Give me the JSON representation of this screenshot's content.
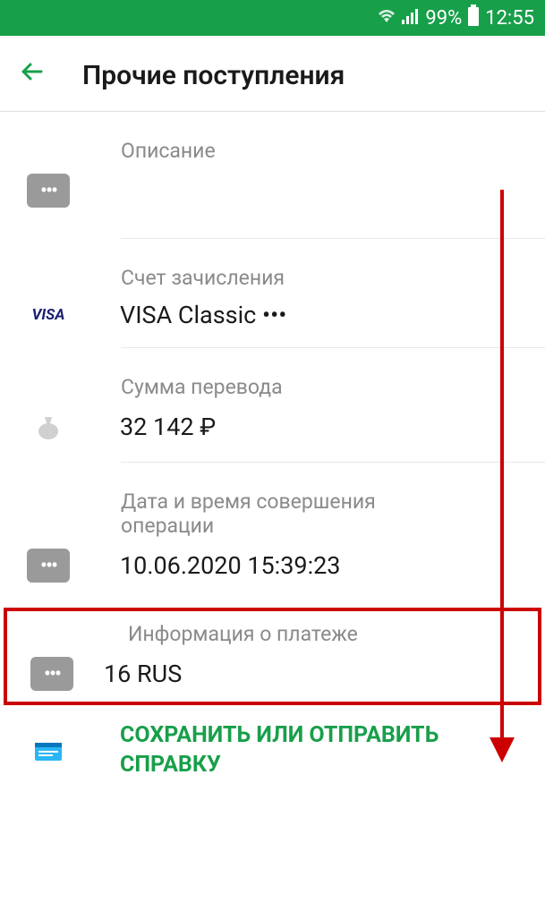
{
  "status_bar": {
    "battery_percent": "99%",
    "time": "12:55"
  },
  "header": {
    "title": "Прочие поступления"
  },
  "sections": {
    "description": {
      "label": "Описание",
      "value": ""
    },
    "account": {
      "label": "Счет зачисления",
      "value": "VISA Classic •••"
    },
    "amount": {
      "label": "Сумма перевода",
      "value": "32 142 ₽"
    },
    "datetime": {
      "label": "Дата и время совершения операции",
      "value": "10.06.2020 15:39:23"
    },
    "payment_info": {
      "label": "Информация о платеже",
      "value": "16 RUS"
    }
  },
  "action": {
    "label": "СОХРАНИТЬ ИЛИ ОТПРАВИТЬ СПРАВКУ"
  }
}
